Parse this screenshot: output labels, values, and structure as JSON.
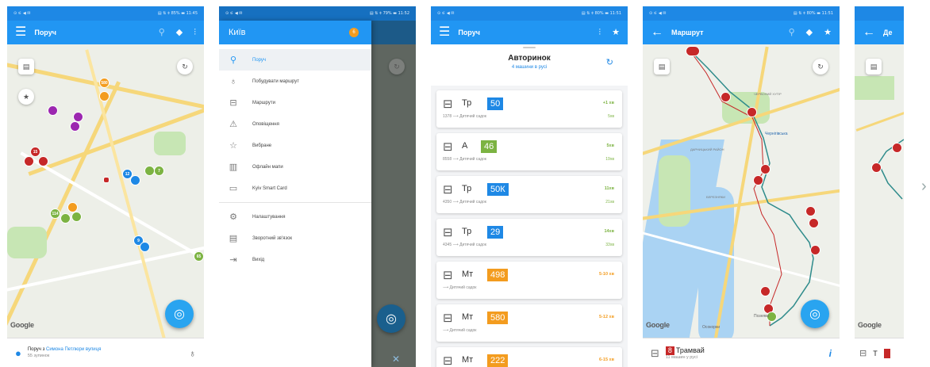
{
  "screens": {
    "nearby": {
      "title": "Поруч",
      "bottom_text_prefix": "Поруч з ",
      "bottom_text_place": "Симона Петлюри вулиця",
      "bottom_sub": "55 зупинок",
      "google": "Google",
      "markers": [
        "580",
        "15",
        "12",
        "114",
        "15",
        "8",
        "7",
        "9",
        "65"
      ]
    },
    "drawer": {
      "title": "Київ",
      "badge": "6",
      "items": [
        {
          "label": "Поруч",
          "icon": "person-pin-icon"
        },
        {
          "label": "Побудувати маршрут",
          "icon": "route-icon"
        },
        {
          "label": "Маршрути",
          "icon": "bus-icon"
        },
        {
          "label": "Оповіщення",
          "icon": "warning-icon"
        },
        {
          "label": "Вибране",
          "icon": "star-icon"
        },
        {
          "label": "Офлайн мапи",
          "icon": "map-icon"
        },
        {
          "label": "Kyiv Smart Card",
          "icon": "card-icon"
        },
        {
          "label": "Налаштування",
          "icon": "settings-icon"
        },
        {
          "label": "Зворотний зв'язок",
          "icon": "feedback-icon"
        },
        {
          "label": "Вихід",
          "icon": "exit-icon"
        }
      ]
    },
    "stop": {
      "title": "Поруч",
      "stop_name": "Авторинок",
      "stop_sub": "4 машини в русі",
      "routes": [
        {
          "type": "Тр",
          "num": "50",
          "color": "#1e88e5",
          "sub": "1378 ⟶ Дитячий садок",
          "eta": "+1 хв",
          "eta2": "5хв",
          "vehicle": "trolleybus"
        },
        {
          "type": "А",
          "num": "46",
          "color": "#7cb342",
          "sub": "8558 ⟶ Дитячий садок",
          "eta": "5хв",
          "eta2": "19хв",
          "vehicle": "bus"
        },
        {
          "type": "Тр",
          "num": "50К",
          "color": "#1e88e5",
          "sub": "4350 ⟶ Дитячий садок",
          "eta": "11хв",
          "eta2": "21хв",
          "vehicle": "trolleybus"
        },
        {
          "type": "Тр",
          "num": "29",
          "color": "#1e88e5",
          "sub": "4345 ⟶ Дитячий садок",
          "eta": "14хв",
          "eta2": "33хв",
          "vehicle": "trolleybus"
        },
        {
          "type": "Мт",
          "num": "498",
          "color": "#f39c1f",
          "sub": "⟶ Дитячий садок",
          "eta": "5-10 хв",
          "eta2": "",
          "vehicle": "minibus"
        },
        {
          "type": "Мт",
          "num": "580",
          "color": "#f39c1f",
          "sub": "⟶ Дитячий садок",
          "eta": "5-12 хв",
          "eta2": "",
          "vehicle": "minibus"
        },
        {
          "type": "Мт",
          "num": "222",
          "color": "#f39c1f",
          "sub": "⟶ Дитячий садок",
          "eta": "6-15 хв",
          "eta2": "",
          "vehicle": "minibus"
        }
      ]
    },
    "route": {
      "title": "Маршрут",
      "bottom_num": "8",
      "bottom_label": "Трамвай",
      "bottom_sub": "11 машин у русі",
      "google": "Google",
      "map_labels": [
        "ЛУК'ЯНІВКА",
        "ЧЕРВОНИЙ ХУТІР",
        "Чернігівська",
        "ДАРНИЦЬКИЙ РАЙОН",
        "БЕРЕЗНЯКИ",
        "ОБОЛОНЬ",
        "Осокорки",
        "Позняки"
      ]
    },
    "partial": {
      "title": "Де",
      "google": "Google",
      "bottom_label": "Т"
    }
  },
  "status_bar": {
    "left": "⊙ ⚟ ◀ ✉",
    "right1": "▤ ⇅ ⌽ 85% ▬ 11:45",
    "right2": "▤ ⇅ ⌽ 79% ▬ 11:52",
    "right3": "▤ ⇅ ⌽ 80% ▬ 11:51",
    "right4": "▤ ⇅ ⌽ 80% ▬ 11:51"
  },
  "colors": {
    "primary": "#2196f3",
    "status": "#1e88e5",
    "tram": "#c62828",
    "trolley": "#1e88e5",
    "bus": "#7cb342",
    "minibus": "#f39c1f"
  }
}
